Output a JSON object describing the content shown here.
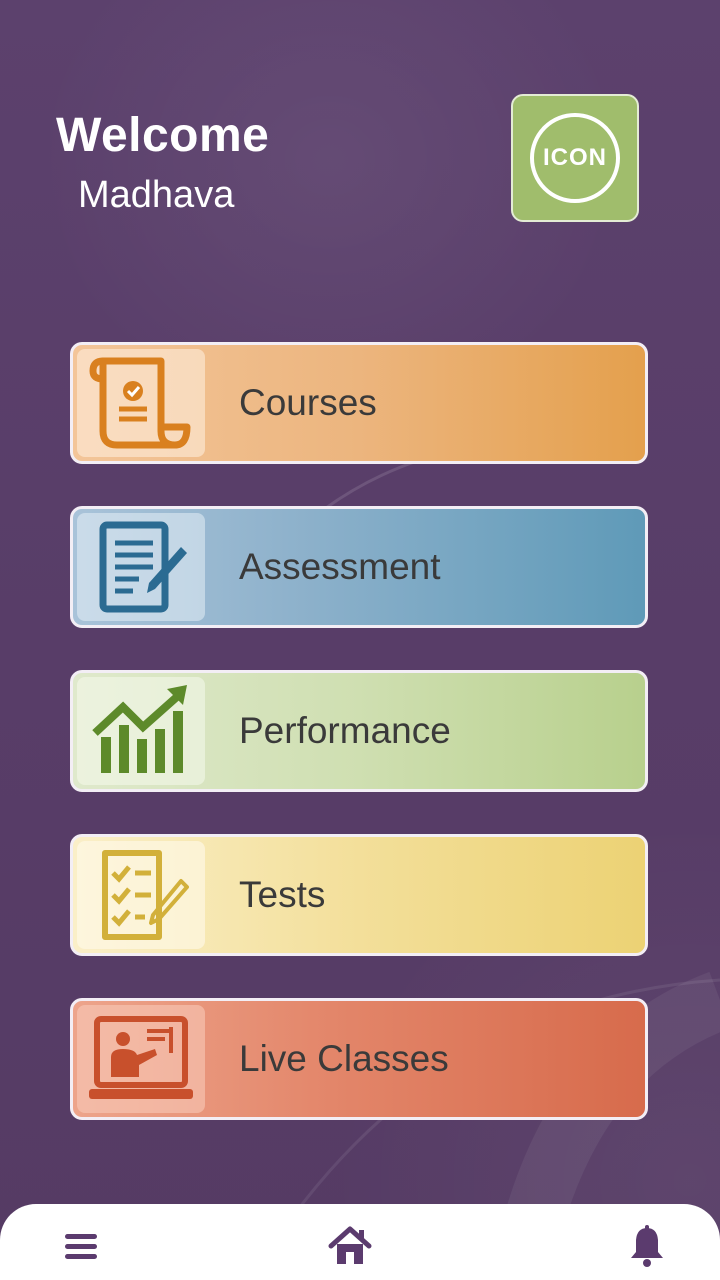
{
  "header": {
    "welcome_label": "Welcome",
    "user_name": "Madhava",
    "profile_icon_text": "ICON"
  },
  "menu": {
    "items": [
      {
        "label": "Courses",
        "icon": "certificate-scroll-icon",
        "color": "#e4a04d"
      },
      {
        "label": "Assessment",
        "icon": "document-edit-icon",
        "color": "#5f9ab8"
      },
      {
        "label": "Performance",
        "icon": "growth-chart-icon",
        "color": "#b8d08d"
      },
      {
        "label": "Tests",
        "icon": "checklist-icon",
        "color": "#ecd274"
      },
      {
        "label": "Live Classes",
        "icon": "online-teacher-icon",
        "color": "#d76b4c"
      }
    ]
  },
  "bottom_nav": {
    "items": [
      {
        "icon": "hamburger-menu-icon"
      },
      {
        "icon": "home-icon"
      },
      {
        "icon": "bell-icon"
      }
    ]
  },
  "colors": {
    "background": "#5a3f6a",
    "profile_accent": "#a0bd6c",
    "nav_icon": "#5b3b6e"
  }
}
